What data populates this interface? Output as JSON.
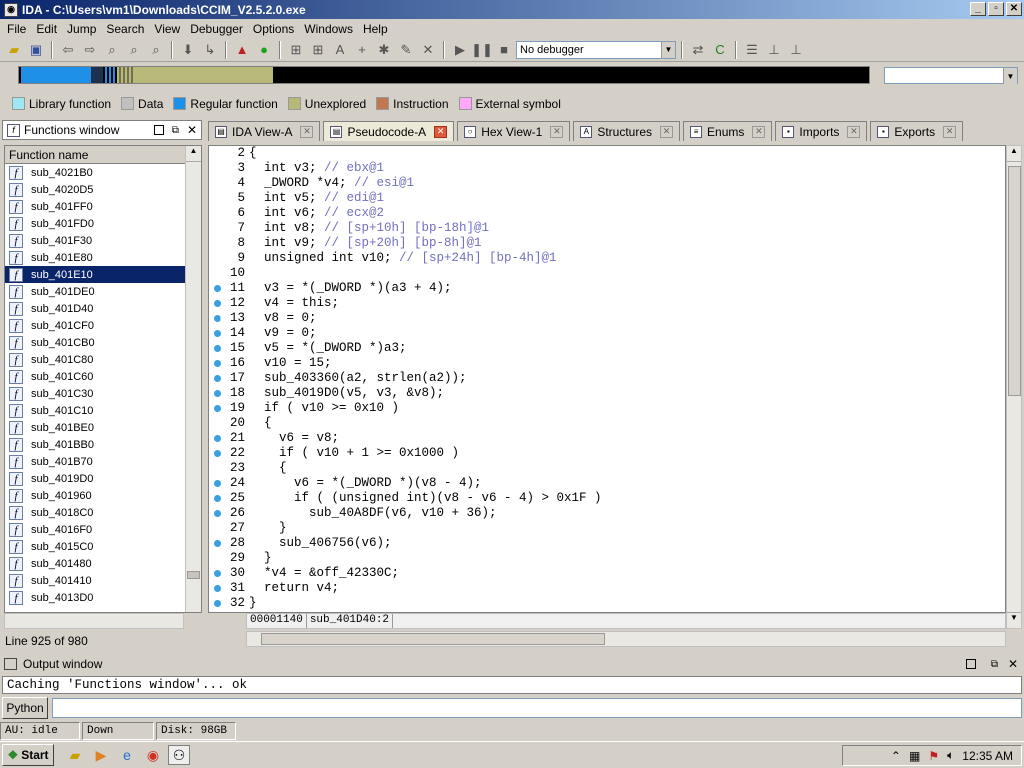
{
  "window": {
    "title": "IDA - C:\\Users\\vm1\\Downloads\\CCIM_V2.5.2.0.exe"
  },
  "menu": [
    "File",
    "Edit",
    "Jump",
    "Search",
    "View",
    "Debugger",
    "Options",
    "Windows",
    "Help"
  ],
  "toolbar": {
    "debugger_value": "No debugger"
  },
  "legend": [
    {
      "label": "Library function",
      "color": "#9fe8f0"
    },
    {
      "label": "Data",
      "color": "#c0c0c0"
    },
    {
      "label": "Regular function",
      "color": "#1e90e8"
    },
    {
      "label": "Unexplored",
      "color": "#b8b878"
    },
    {
      "label": "Instruction",
      "color": "#c07850"
    },
    {
      "label": "External symbol",
      "color": "#ffa8f8"
    }
  ],
  "functions": {
    "title": "Functions window",
    "header": "Function name",
    "selected": "sub_401E10",
    "items": [
      "sub_4021B0",
      "sub_4020D5",
      "sub_401FF0",
      "sub_401FD0",
      "sub_401F30",
      "sub_401E80",
      "sub_401E10",
      "sub_401DE0",
      "sub_401D40",
      "sub_401CF0",
      "sub_401CB0",
      "sub_401C80",
      "sub_401C60",
      "sub_401C30",
      "sub_401C10",
      "sub_401BE0",
      "sub_401BB0",
      "sub_401B70",
      "sub_4019D0",
      "sub_401960",
      "sub_4018C0",
      "sub_4016F0",
      "sub_4015C0",
      "sub_401480",
      "sub_401410",
      "sub_4013D0"
    ],
    "status": "Line 925 of 980"
  },
  "tabs": [
    {
      "label": "IDA View-A",
      "active": false
    },
    {
      "label": "Pseudocode-A",
      "active": true
    },
    {
      "label": "Hex View-1",
      "active": false
    },
    {
      "label": "Structures",
      "active": false
    },
    {
      "label": "Enums",
      "active": false
    },
    {
      "label": "Imports",
      "active": false
    },
    {
      "label": "Exports",
      "active": false
    }
  ],
  "code": [
    {
      "n": "2",
      "dot": false,
      "t": "{"
    },
    {
      "n": "3",
      "dot": false,
      "t": "  int v3; // ebx@1"
    },
    {
      "n": "4",
      "dot": false,
      "t": "  _DWORD *v4; // esi@1"
    },
    {
      "n": "5",
      "dot": false,
      "t": "  int v5; // edi@1"
    },
    {
      "n": "6",
      "dot": false,
      "t": "  int v6; // ecx@2"
    },
    {
      "n": "7",
      "dot": false,
      "t": "  int v8; // [sp+10h] [bp-18h]@1"
    },
    {
      "n": "8",
      "dot": false,
      "t": "  int v9; // [sp+20h] [bp-8h]@1"
    },
    {
      "n": "9",
      "dot": false,
      "t": "  unsigned int v10; // [sp+24h] [bp-4h]@1"
    },
    {
      "n": "10",
      "dot": false,
      "t": ""
    },
    {
      "n": "11",
      "dot": true,
      "t": "  v3 = *(_DWORD *)(a3 + 4);"
    },
    {
      "n": "12",
      "dot": true,
      "t": "  v4 = this;"
    },
    {
      "n": "13",
      "dot": true,
      "t": "  v8 = 0;"
    },
    {
      "n": "14",
      "dot": true,
      "t": "  v9 = 0;"
    },
    {
      "n": "15",
      "dot": true,
      "t": "  v5 = *(_DWORD *)a3;"
    },
    {
      "n": "16",
      "dot": true,
      "t": "  v10 = 15;"
    },
    {
      "n": "17",
      "dot": true,
      "t": "  sub_403360(a2, strlen(a2));"
    },
    {
      "n": "18",
      "dot": true,
      "t": "  sub_4019D0(v5, v3, &v8);"
    },
    {
      "n": "19",
      "dot": true,
      "t": "  if ( v10 >= 0x10 )"
    },
    {
      "n": "20",
      "dot": false,
      "t": "  {"
    },
    {
      "n": "21",
      "dot": true,
      "t": "    v6 = v8;"
    },
    {
      "n": "22",
      "dot": true,
      "t": "    if ( v10 + 1 >= 0x1000 )"
    },
    {
      "n": "23",
      "dot": false,
      "t": "    {"
    },
    {
      "n": "24",
      "dot": true,
      "t": "      v6 = *(_DWORD *)(v8 - 4);"
    },
    {
      "n": "25",
      "dot": true,
      "t": "      if ( (unsigned int)(v8 - v6 - 4) > 0x1F )"
    },
    {
      "n": "26",
      "dot": true,
      "t": "        sub_40A8DF(v6, v10 + 36);"
    },
    {
      "n": "27",
      "dot": false,
      "t": "    }"
    },
    {
      "n": "28",
      "dot": true,
      "t": "    sub_406756(v6);"
    },
    {
      "n": "29",
      "dot": false,
      "t": "  }"
    },
    {
      "n": "30",
      "dot": true,
      "t": "  *v4 = &off_42330C;"
    },
    {
      "n": "31",
      "dot": true,
      "t": "  return v4;"
    },
    {
      "n": "32",
      "dot": true,
      "t": "}"
    }
  ],
  "addr": {
    "offset": "00001140",
    "location": "sub_401D40:2"
  },
  "output": {
    "title": "Output window",
    "text": "Caching 'Functions window'... ok",
    "python_label": "Python"
  },
  "status": {
    "au": "AU:  idle",
    "dir": "Down",
    "disk": "Disk: 98GB"
  },
  "taskbar": {
    "start": "Start",
    "clock": "12:35 AM"
  }
}
